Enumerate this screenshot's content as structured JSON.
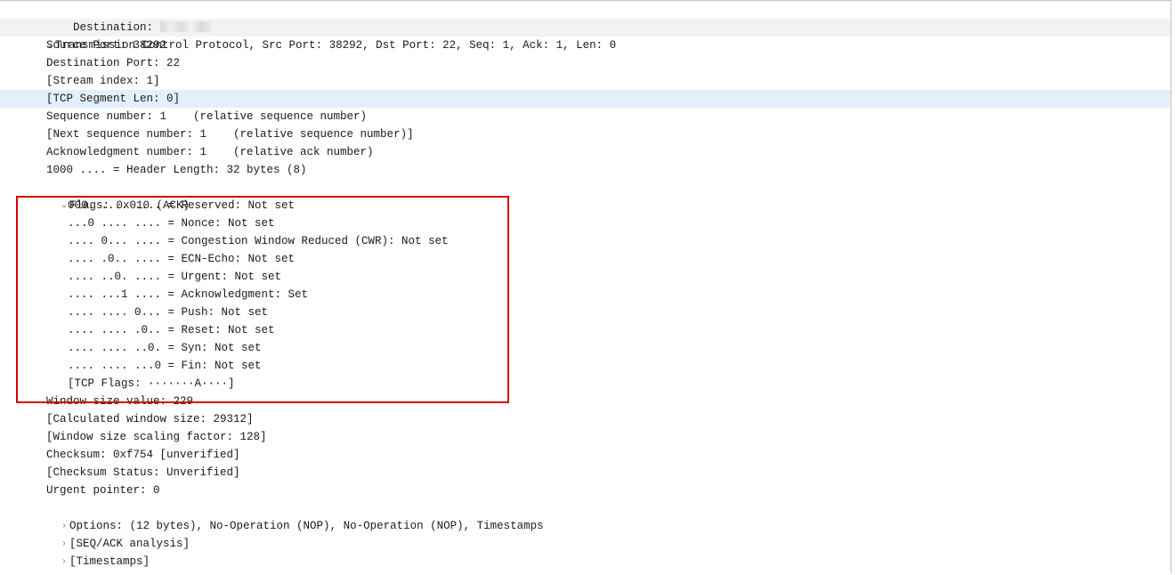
{
  "top": {
    "destination_label": "Destination: "
  },
  "tcp": {
    "header": "Transmission Control Protocol, Src Port: 38292, Dst Port: 22, Seq: 1, Ack: 1, Len: 0",
    "src_port": "Source Port: 38292",
    "dst_port": "Destination Port: 22",
    "stream_index": "[Stream index: 1]",
    "seg_len": "[TCP Segment Len: 0]",
    "seq_num": "Sequence number: 1    (relative sequence number)",
    "next_seq": "[Next sequence number: 1    (relative sequence number)]",
    "ack_num": "Acknowledgment number: 1    (relative ack number)",
    "hdr_len": "1000 .... = Header Length: 32 bytes (8)",
    "flags_header": "Flags: 0x010 (ACK)",
    "flags": {
      "reserved": "000. .... .... = Reserved: Not set",
      "nonce": "...0 .... .... = Nonce: Not set",
      "cwr": ".... 0... .... = Congestion Window Reduced (CWR): Not set",
      "ecn": ".... .0.. .... = ECN-Echo: Not set",
      "urg": ".... ..0. .... = Urgent: Not set",
      "ack": ".... ...1 .... = Acknowledgment: Set",
      "psh": ".... .... 0... = Push: Not set",
      "rst": ".... .... .0.. = Reset: Not set",
      "syn": ".... .... ..0. = Syn: Not set",
      "fin": ".... .... ...0 = Fin: Not set",
      "summary": "[TCP Flags: ·······A····]"
    },
    "win_size": "Window size value: 229",
    "calc_win": "[Calculated window size: 29312]",
    "win_scale": "[Window size scaling factor: 128]",
    "checksum": "Checksum: 0xf754 [unverified]",
    "chk_status": "[Checksum Status: Unverified]",
    "urg_ptr": "Urgent pointer: 0",
    "options": "Options: (12 bytes), No-Operation (NOP), No-Operation (NOP), Timestamps",
    "seq_ack": "[SEQ/ACK analysis]",
    "timestamps": "[Timestamps]"
  },
  "glyphs": {
    "expanded": "⌄",
    "collapsed": "›"
  }
}
